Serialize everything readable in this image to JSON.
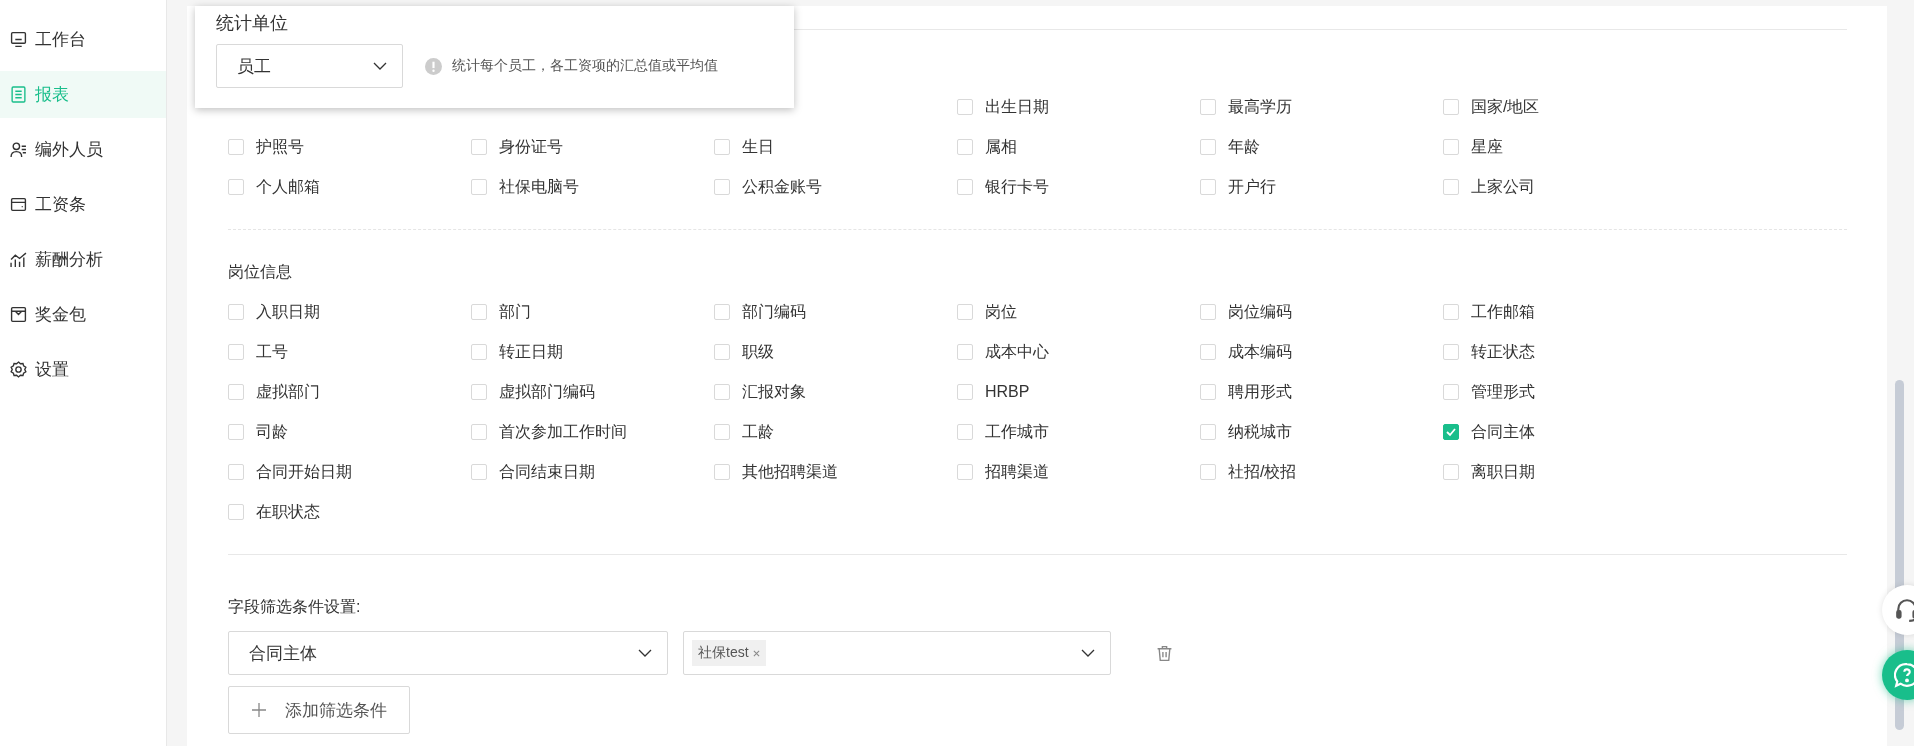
{
  "sidebar": {
    "items": [
      {
        "label": "工作台",
        "selected": false
      },
      {
        "label": "报表",
        "selected": true
      },
      {
        "label": "编外人员",
        "selected": false
      },
      {
        "label": "工资条",
        "selected": false
      },
      {
        "label": "薪酬分析",
        "selected": false
      },
      {
        "label": "奖金包",
        "selected": false
      },
      {
        "label": "设置",
        "selected": false
      }
    ]
  },
  "popup": {
    "title": "统计单位",
    "select": {
      "value": "员工"
    },
    "hint": "统计每个员工，各工资项的汇总值或平均值"
  },
  "sections": [
    {
      "items": [
        {
          "label": "出生日期",
          "checked": false
        },
        {
          "label": "最高学历",
          "checked": false
        },
        {
          "label": "国家/地区",
          "checked": false
        },
        {
          "label": "护照号",
          "checked": false
        },
        {
          "label": "身份证号",
          "checked": false
        },
        {
          "label": "生日",
          "checked": false
        },
        {
          "label": "属相",
          "checked": false
        },
        {
          "label": "年龄",
          "checked": false
        },
        {
          "label": "星座",
          "checked": false
        },
        {
          "label": "个人邮箱",
          "checked": false
        },
        {
          "label": "社保电脑号",
          "checked": false
        },
        {
          "label": "公积金账号",
          "checked": false
        },
        {
          "label": "银行卡号",
          "checked": false
        },
        {
          "label": "开户行",
          "checked": false
        },
        {
          "label": "上家公司",
          "checked": false
        }
      ]
    },
    {
      "title": "岗位信息",
      "items": [
        {
          "label": "入职日期",
          "checked": false
        },
        {
          "label": "部门",
          "checked": false
        },
        {
          "label": "部门编码",
          "checked": false
        },
        {
          "label": "岗位",
          "checked": false
        },
        {
          "label": "岗位编码",
          "checked": false
        },
        {
          "label": "工作邮箱",
          "checked": false
        },
        {
          "label": "工号",
          "checked": false
        },
        {
          "label": "转正日期",
          "checked": false
        },
        {
          "label": "职级",
          "checked": false
        },
        {
          "label": "成本中心",
          "checked": false
        },
        {
          "label": "成本编码",
          "checked": false
        },
        {
          "label": "转正状态",
          "checked": false
        },
        {
          "label": "虚拟部门",
          "checked": false
        },
        {
          "label": "虚拟部门编码",
          "checked": false
        },
        {
          "label": "汇报对象",
          "checked": false
        },
        {
          "label": "HRBP",
          "checked": false
        },
        {
          "label": "聘用形式",
          "checked": false
        },
        {
          "label": "管理形式",
          "checked": false
        },
        {
          "label": "司龄",
          "checked": false
        },
        {
          "label": "首次参加工作时间",
          "checked": false
        },
        {
          "label": "工龄",
          "checked": false
        },
        {
          "label": "工作城市",
          "checked": false
        },
        {
          "label": "纳税城市",
          "checked": false
        },
        {
          "label": "合同主体",
          "checked": true
        },
        {
          "label": "合同开始日期",
          "checked": false
        },
        {
          "label": "合同结束日期",
          "checked": false
        },
        {
          "label": "其他招聘渠道",
          "checked": false
        },
        {
          "label": "招聘渠道",
          "checked": false
        },
        {
          "label": "社招/校招",
          "checked": false
        },
        {
          "label": "离职日期",
          "checked": false
        },
        {
          "label": "在职状态",
          "checked": false
        }
      ]
    }
  ],
  "filter": {
    "label": "字段筛选条件设置:",
    "rows": [
      {
        "field": "合同主体",
        "tags": [
          "社保test"
        ]
      }
    ],
    "add_button": "添加筛选条件"
  }
}
